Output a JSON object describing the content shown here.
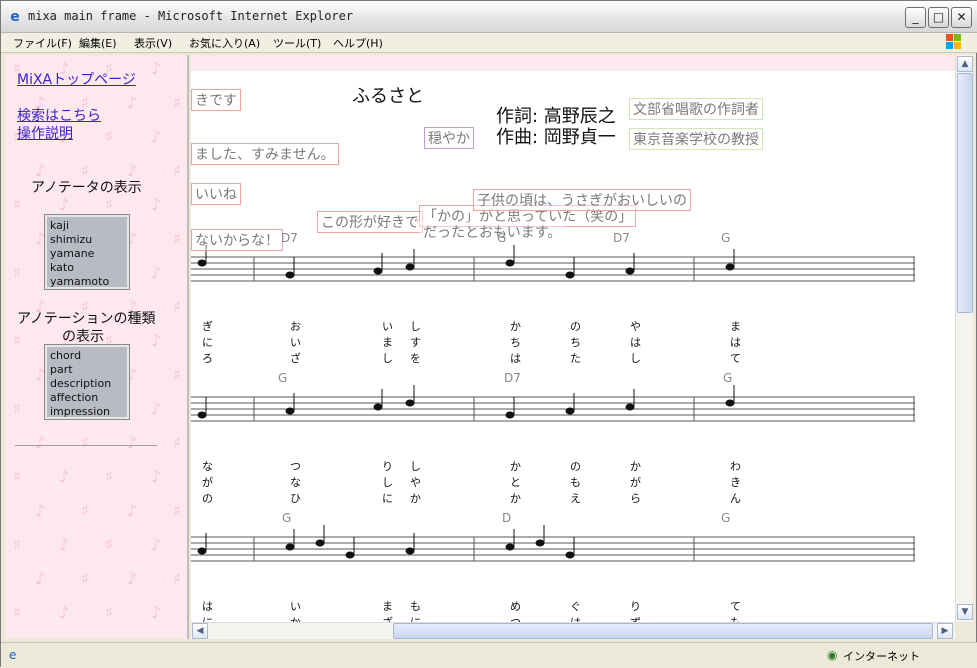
{
  "window": {
    "title": "mixa main frame - Microsoft Internet Explorer"
  },
  "menu": [
    "ファイル(F)",
    "編集(E)",
    "表示(V)",
    "お気に入り(A)",
    "ツール(T)",
    "ヘルプ(H)"
  ],
  "sidebar": {
    "top_link": "MiXAトップページ",
    "search_link": "検索はこちら",
    "help_link": "操作説明",
    "annotator_heading": "アノテータの表示",
    "annotators": [
      "kaji",
      "shimizu",
      "yamane",
      "kato",
      "yamamoto"
    ],
    "types_heading_1": "アノテーションの種類",
    "types_heading_2": "の表示",
    "types": [
      "chord",
      "part",
      "description",
      "affection",
      "impression"
    ]
  },
  "score": {
    "title": "ふるさと",
    "lyricist": "作詞: 高野辰之",
    "composer": "作曲: 岡野貞一",
    "annotations": {
      "a1": "きです",
      "a2": "ました、すみません。",
      "a3": "いいね",
      "a4": "ないからな！",
      "a5": "この形が好きで",
      "a6": "「かの」がと思っていた（笑の」",
      "a7": "だったとおもいます。",
      "a8": "子供の頃は、うさぎがおいしいの",
      "a9": "穏やか",
      "a10": "文部省唱歌の作詞者",
      "a11": "東京音楽学校の教授"
    },
    "chords": {
      "r1": [
        "D7",
        "G",
        "D7",
        "G"
      ],
      "r2": [
        "G",
        "D7",
        "G"
      ],
      "r3": [
        "G",
        "D",
        "G"
      ]
    },
    "lyrics": {
      "r1": [
        [
          "ぎ",
          "に",
          "ろ"
        ],
        [
          "お",
          "い",
          "ざ"
        ],
        [
          "い",
          "ま",
          "し"
        ],
        [
          "し",
          "す",
          "を"
        ],
        [
          "か",
          "ち",
          "は"
        ],
        [
          "の",
          "ち",
          "た"
        ],
        [
          "や",
          "は",
          "し"
        ],
        [
          "ま",
          "は",
          "て"
        ]
      ],
      "r2": [
        [
          "な",
          "が",
          "の"
        ],
        [
          "つ",
          "な",
          "ひ"
        ],
        [
          "り",
          "し",
          "に"
        ],
        [
          "し",
          "や",
          "か"
        ],
        [
          "か",
          "と",
          "か"
        ],
        [
          "の",
          "も",
          "え"
        ],
        [
          "か",
          "が",
          "ら"
        ],
        [
          "わ",
          "き",
          "ん"
        ]
      ],
      "r3": [
        [
          "は",
          "に"
        ],
        [
          "い",
          "か"
        ],
        [
          "ま",
          "ざ"
        ],
        [
          "も",
          "に"
        ],
        [
          "め",
          "つ"
        ],
        [
          "ぐ",
          "は"
        ],
        [
          "り",
          "ず"
        ],
        [
          "て",
          "も"
        ]
      ]
    }
  },
  "status": {
    "zone": "インターネット"
  }
}
